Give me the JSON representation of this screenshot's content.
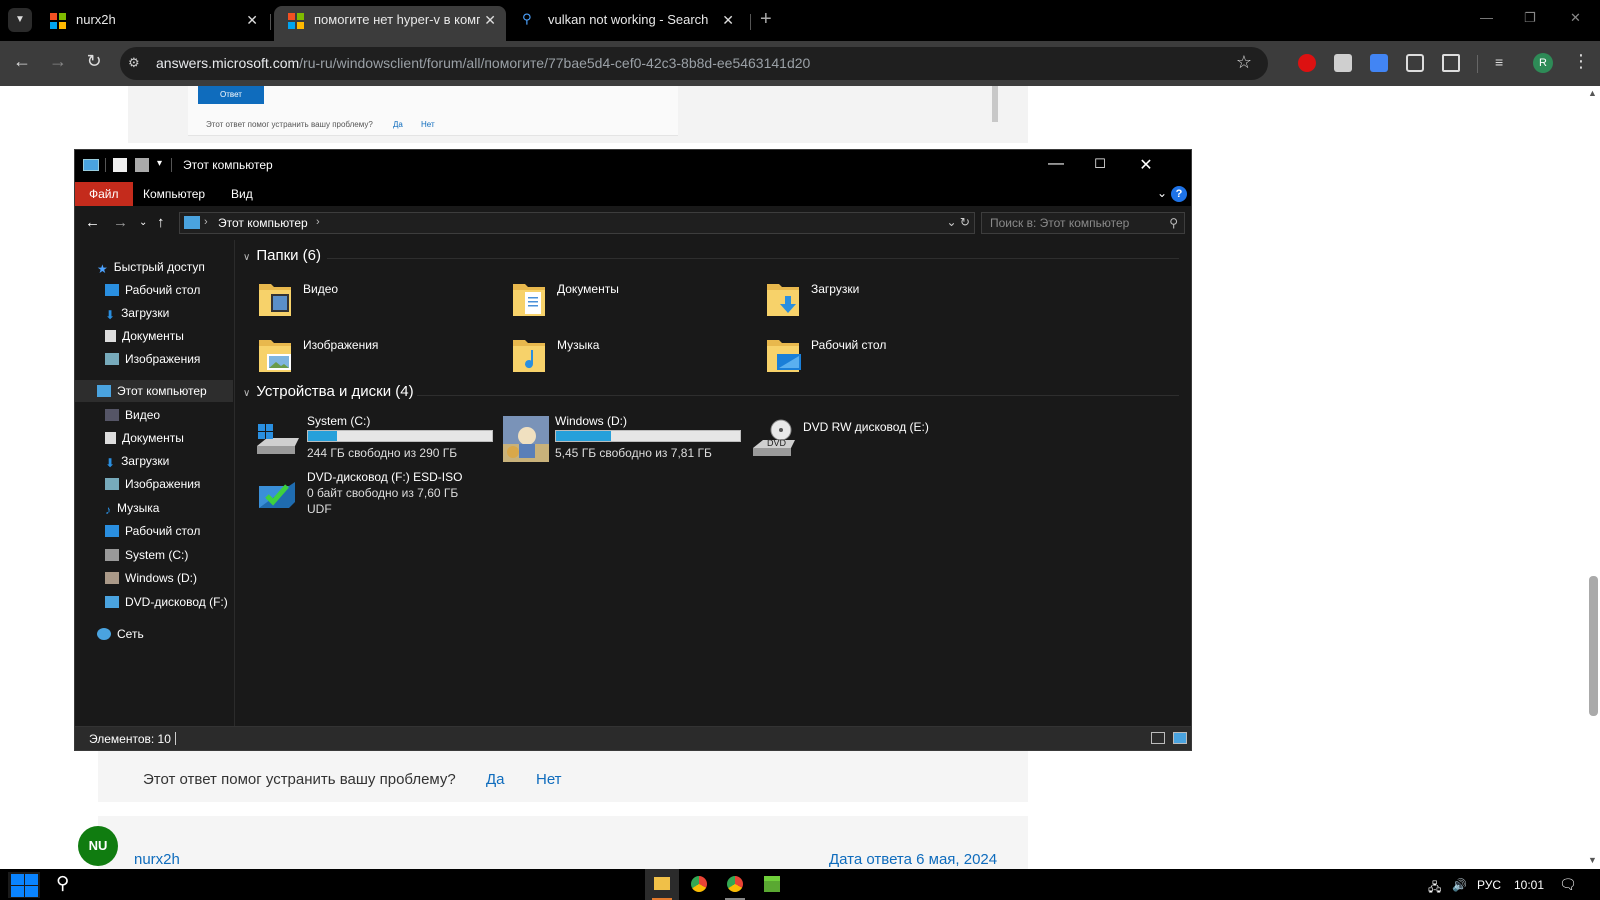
{
  "browser": {
    "tabs": [
      {
        "title": "nurx2h",
        "active": false
      },
      {
        "title": "помогите нет hyper-v в компо",
        "active": true
      },
      {
        "title": "vulkan not working - Search",
        "active": false
      }
    ],
    "url_host": "answers.microsoft.com",
    "url_path": "/ru-ru/windowsclient/forum/all/помогите/77bae5d4-cef0-42c3-8b8d-ee5463141d20",
    "profile_initial": "R"
  },
  "page": {
    "reply_button": "Ответ",
    "small_question": "Этот ответ помог устранить вашу проблему?",
    "small_yes": "Да",
    "small_no": "Нет",
    "help_question": "Этот ответ помог устранить вашу проблему?",
    "help_yes": "Да",
    "help_no": "Нет",
    "avatar_initials": "NU",
    "author": "nurx2h",
    "answer_date": "Дата ответа 6 мая, 2024"
  },
  "explorer": {
    "title": "Этот компьютер",
    "ribbon_tabs": [
      "Файл",
      "Компьютер",
      "Вид"
    ],
    "address": "Этот компьютер",
    "search_placeholder": "Поиск в: Этот компьютер",
    "sidebar": [
      {
        "label": "Быстрый доступ",
        "level": 0,
        "icon": "star-icon",
        "pinned": false
      },
      {
        "label": "Рабочий стол",
        "level": 1,
        "icon": "desktop-icon",
        "pinned": true
      },
      {
        "label": "Загрузки",
        "level": 1,
        "icon": "download-icon",
        "pinned": true
      },
      {
        "label": "Документы",
        "level": 1,
        "icon": "document-icon",
        "pinned": true
      },
      {
        "label": "Изображения",
        "level": 1,
        "icon": "image-icon",
        "pinned": true
      },
      {
        "label": "Этот компьютер",
        "level": 0,
        "icon": "computer-icon",
        "selected": true
      },
      {
        "label": "Видео",
        "level": 1,
        "icon": "video-icon"
      },
      {
        "label": "Документы",
        "level": 1,
        "icon": "document-icon"
      },
      {
        "label": "Загрузки",
        "level": 1,
        "icon": "download-icon"
      },
      {
        "label": "Изображения",
        "level": 1,
        "icon": "image-icon"
      },
      {
        "label": "Музыка",
        "level": 1,
        "icon": "music-icon"
      },
      {
        "label": "Рабочий стол",
        "level": 1,
        "icon": "desktop-icon"
      },
      {
        "label": "System (C:)",
        "level": 1,
        "icon": "drive-icon"
      },
      {
        "label": "Windows (D:)",
        "level": 1,
        "icon": "drive-image-icon"
      },
      {
        "label": "DVD-дисковод (F:)",
        "level": 1,
        "icon": "dvd-icon"
      },
      {
        "label": "Сеть",
        "level": 0,
        "icon": "network-icon"
      }
    ],
    "folders_header": "Папки (6)",
    "folders": [
      {
        "label": "Видео",
        "icon": "video-folder-icon"
      },
      {
        "label": "Документы",
        "icon": "documents-folder-icon"
      },
      {
        "label": "Загрузки",
        "icon": "downloads-folder-icon"
      },
      {
        "label": "Изображения",
        "icon": "pictures-folder-icon"
      },
      {
        "label": "Музыка",
        "icon": "music-folder-icon"
      },
      {
        "label": "Рабочий стол",
        "icon": "desktop-folder-icon"
      }
    ],
    "drives_header": "Устройства и диски (4)",
    "drives": [
      {
        "name": "System (C:)",
        "free": "244 ГБ свободно из 290 ГБ",
        "used_fraction": 0.16,
        "icon": "windows-drive-icon"
      },
      {
        "name": "Windows (D:)",
        "free": "5,45 ГБ свободно из 7,81 ГБ",
        "used_fraction": 0.3,
        "icon": "custom-drive-icon"
      },
      {
        "name": "DVD RW дисковод (E:)",
        "icon": "dvd-drive-icon"
      },
      {
        "name": "DVD-дисковод (F:) ESD-ISO",
        "free": "0 байт свободно из 7,60 ГБ",
        "fs": "UDF",
        "icon": "iso-drive-icon"
      }
    ],
    "status": "Элементов: 10"
  },
  "taskbar": {
    "language": "РУС",
    "time": "10:01"
  },
  "colors": {
    "accent_blue": "#0f6cbd",
    "file_tab_red": "#c42b1c",
    "drive_bar": "#26a0da"
  }
}
